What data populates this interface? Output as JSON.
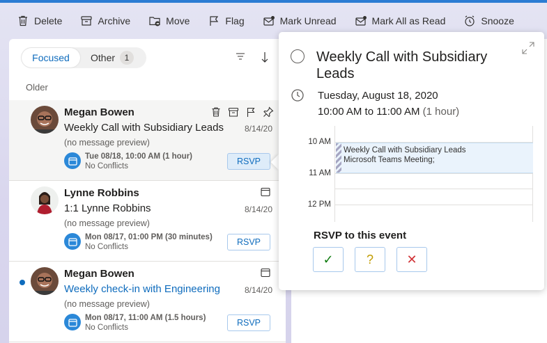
{
  "toolbar": {
    "delete": "Delete",
    "archive": "Archive",
    "move": "Move",
    "flag": "Flag",
    "mark_unread": "Mark Unread",
    "mark_all_read": "Mark All as Read",
    "snooze": "Snooze"
  },
  "list": {
    "focused_tab": "Focused",
    "other_tab": "Other",
    "other_count": "1",
    "section_label": "Older",
    "items": [
      {
        "sender": "Megan Bowen",
        "subject": "Weekly Call with Subsidiary Leads",
        "date": "8/14/20",
        "preview": "(no message preview)",
        "event_time": "Tue 08/18, 10:00 AM (1 hour)",
        "conflicts": "No Conflicts",
        "rsvp": "RSVP"
      },
      {
        "sender": "Lynne Robbins",
        "subject": "1:1 Lynne Robbins",
        "date": "8/14/20",
        "preview": "(no message preview)",
        "event_time": "Mon 08/17, 01:00 PM (30 minutes)",
        "conflicts": "No Conflicts",
        "rsvp": "RSVP"
      },
      {
        "sender": "Megan Bowen",
        "subject": "Weekly check-in with Engineering",
        "date": "8/14/20",
        "preview": "(no message preview)",
        "event_time": "Mon 08/17, 11:00 AM (1.5 hours)",
        "conflicts": "No Conflicts",
        "rsvp": "RSVP"
      }
    ]
  },
  "event_card": {
    "title": "Weekly Call with Subsidiary Leads",
    "date": "Tuesday, August 18, 2020",
    "time_range": "10:00 AM to 11:00 AM",
    "duration": "(1 hour)",
    "timeline_labels": [
      "10 AM",
      "11 AM",
      "12 PM"
    ],
    "event_block_name": "Weekly Call with Subsidiary Leads",
    "event_block_location": "Microsoft Teams Meeting;",
    "rsvp_heading": "RSVP to this event",
    "rsvp_accept": "✓",
    "rsvp_tentative": "?",
    "rsvp_decline": "✕"
  },
  "colors": {
    "accent": "#0f6cbd",
    "accept": "#107c10",
    "tentative": "#c19c00",
    "decline": "#d13438"
  }
}
